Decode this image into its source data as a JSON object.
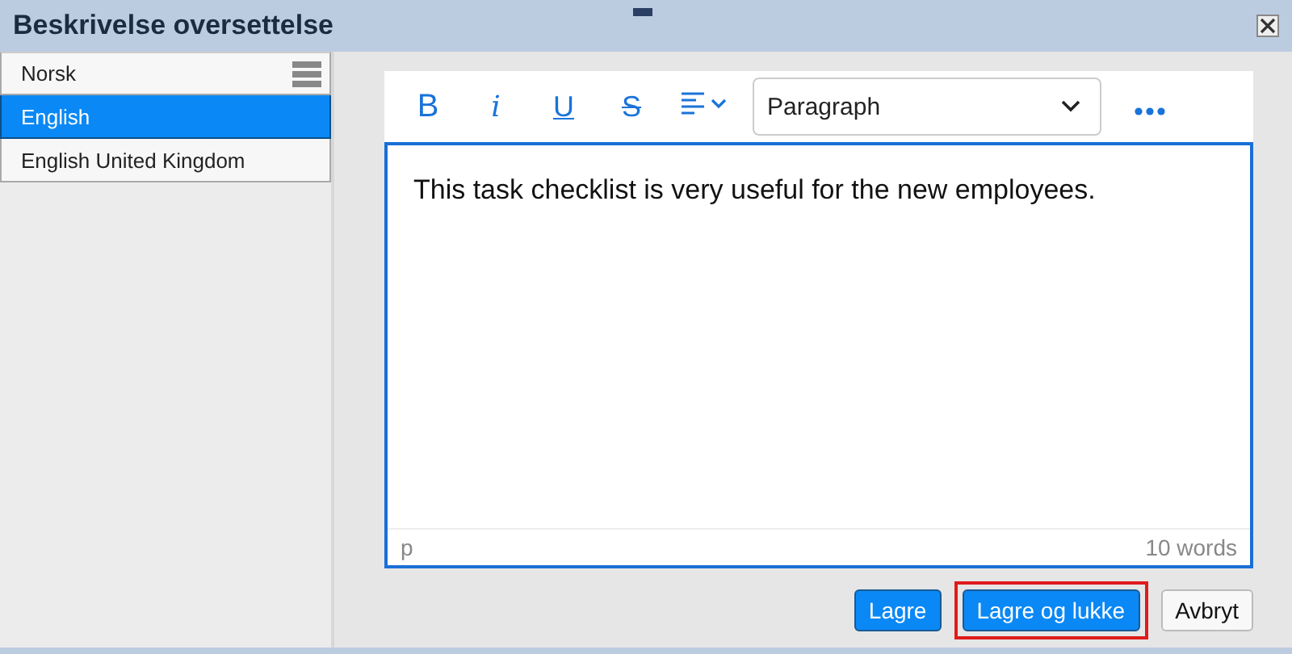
{
  "window": {
    "title": "Beskrivelse oversettelse"
  },
  "languages": [
    {
      "label": "Norsk",
      "selected": false,
      "menu": true
    },
    {
      "label": "English",
      "selected": true,
      "menu": false
    },
    {
      "label": "English United Kingdom",
      "selected": false,
      "menu": false
    }
  ],
  "toolbar": {
    "format_buttons": [
      {
        "label": "B",
        "kind": "bold"
      },
      {
        "label": "i",
        "kind": "italic"
      },
      {
        "label": "U",
        "kind": "underline"
      },
      {
        "label": "S",
        "kind": "strike"
      }
    ],
    "block_format": "Paragraph"
  },
  "editor": {
    "value": "This task checklist is very useful for the new employees.",
    "element_path": "p",
    "word_count": "10 words"
  },
  "buttons": [
    {
      "label": "Lagre",
      "kind": "primary",
      "highlighted": false
    },
    {
      "label": "Lagre og lukke",
      "kind": "primary",
      "highlighted": true
    },
    {
      "label": "Avbryt",
      "kind": "secondary",
      "highlighted": false
    }
  ]
}
